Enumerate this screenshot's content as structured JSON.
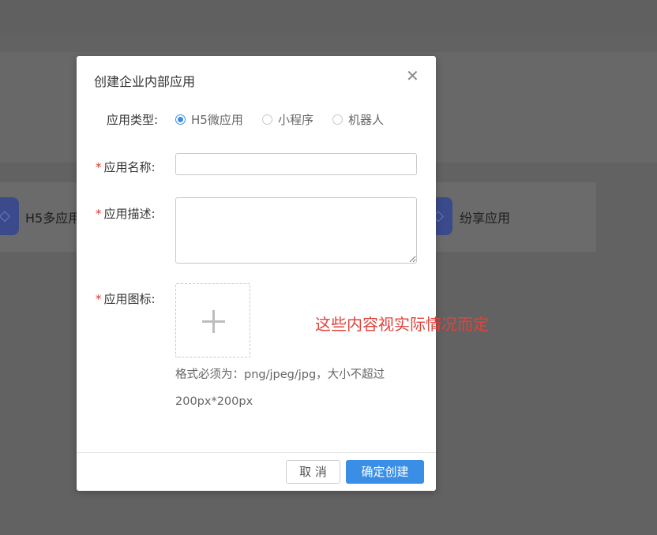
{
  "background": {
    "cards": [
      {
        "label": "H5多应用",
        "icon": "diamond-tag-icon"
      },
      {
        "label": "纷享应用",
        "icon": "diamond-tag-icon"
      }
    ]
  },
  "dialog": {
    "title": "创建企业内部应用",
    "close_icon": "close-icon",
    "type": {
      "label": "应用类型:",
      "options": [
        "H5微应用",
        "小程序",
        "机器人"
      ],
      "selected": "H5微应用"
    },
    "name": {
      "label": "应用名称:",
      "required_mark": "*",
      "value": "",
      "placeholder": ""
    },
    "description": {
      "label": "应用描述:",
      "required_mark": "*",
      "value": "",
      "placeholder": ""
    },
    "icon": {
      "label": "应用图标:",
      "required_mark": "*",
      "upload_icon": "plus-icon",
      "hint_line1": "格式必须为：png/jpeg/jpg，大小不超过",
      "hint_line2": "200px*200px"
    },
    "annotation": "这些内容视实际情况而定",
    "buttons": {
      "cancel": "取 消",
      "confirm": "确定创建"
    }
  },
  "colors": {
    "overlay": "#626262",
    "accent": "#3a8ee6",
    "required": "#e0322d",
    "annotation": "#e0443c"
  }
}
